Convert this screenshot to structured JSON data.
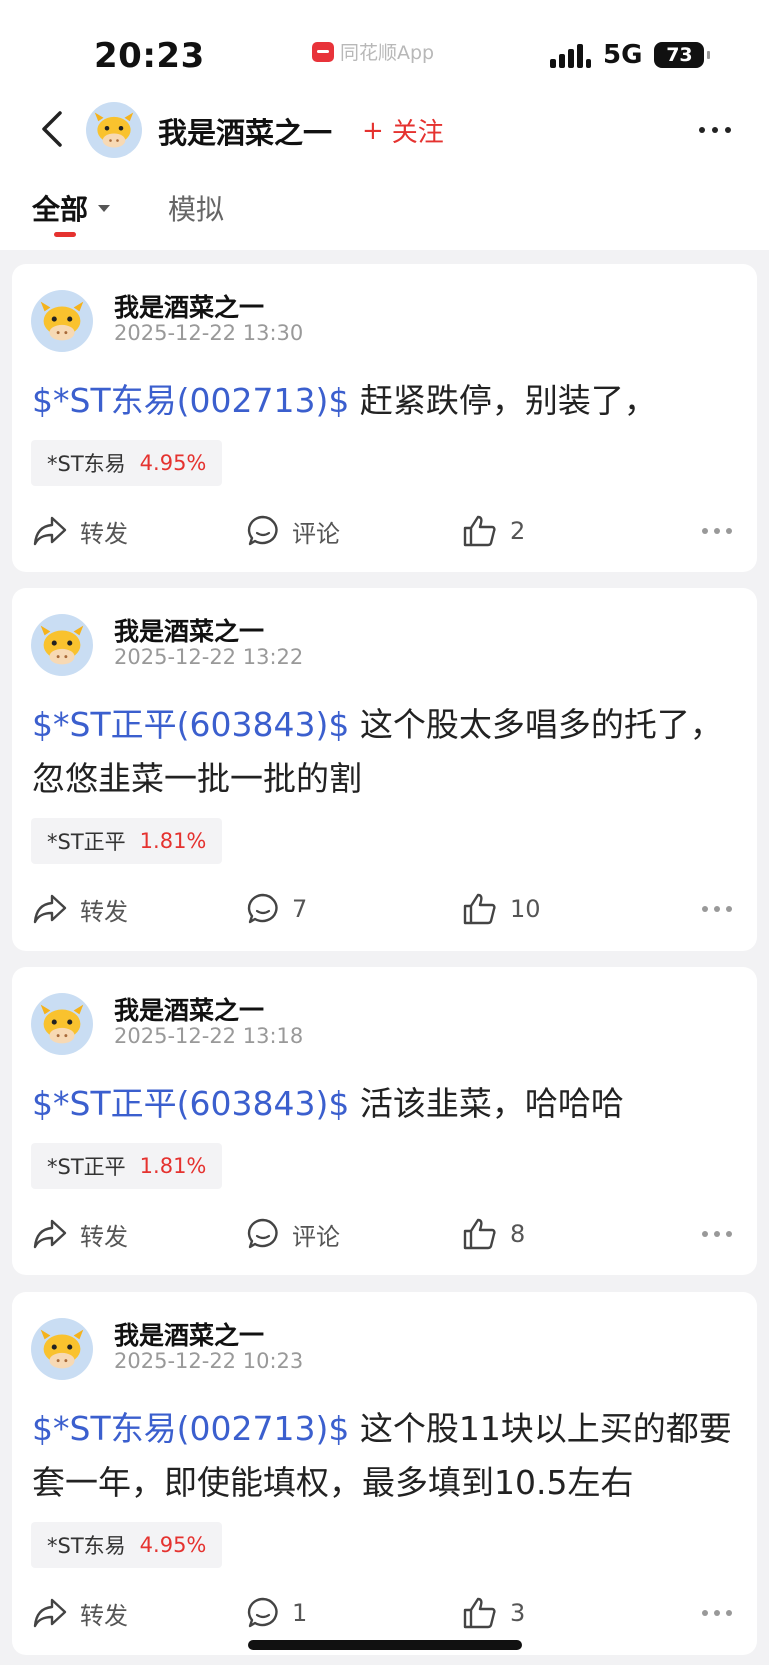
{
  "status_bar": {
    "time": "20:23",
    "app_label": "同花顺App",
    "network": "5G",
    "battery": "73"
  },
  "header": {
    "name": "我是酒菜之一",
    "follow_label": "关注",
    "follow_symbol": "+"
  },
  "tabs": {
    "all": "全部",
    "simulated": "模拟"
  },
  "colors": {
    "accent_red": "#e5322f",
    "stock_link_blue": "#3b5fce"
  },
  "posts": [
    {
      "author": "我是酒菜之一",
      "time": "2025-12-22 13:30",
      "stock_link": "$*ST东易(002713)$",
      "text": " 赶紧跌停，别装了，",
      "tag_name": "*ST东易",
      "tag_pct": "4.95%",
      "share_label": "转发",
      "comment_label": "评论",
      "likes": "2"
    },
    {
      "author": "我是酒菜之一",
      "time": "2025-12-22 13:22",
      "stock_link": "$*ST正平(603843)$",
      "text": " 这个股太多唱多的托了，忽悠韭菜一批一批的割",
      "tag_name": "*ST正平",
      "tag_pct": "1.81%",
      "share_label": "转发",
      "comment_label": "7",
      "likes": "10"
    },
    {
      "author": "我是酒菜之一",
      "time": "2025-12-22 13:18",
      "stock_link": "$*ST正平(603843)$",
      "text": " 活该韭菜，哈哈哈",
      "tag_name": "*ST正平",
      "tag_pct": "1.81%",
      "share_label": "转发",
      "comment_label": "评论",
      "likes": "8"
    },
    {
      "author": "我是酒菜之一",
      "time": "2025-12-22 10:23",
      "stock_link": "$*ST东易(002713)$",
      "text": " 这个股11块以上买的都要套一年，即使能填权，最多填到10.5左右",
      "tag_name": "*ST东易",
      "tag_pct": "4.95%",
      "share_label": "转发",
      "comment_label": "1",
      "likes": "3"
    }
  ]
}
